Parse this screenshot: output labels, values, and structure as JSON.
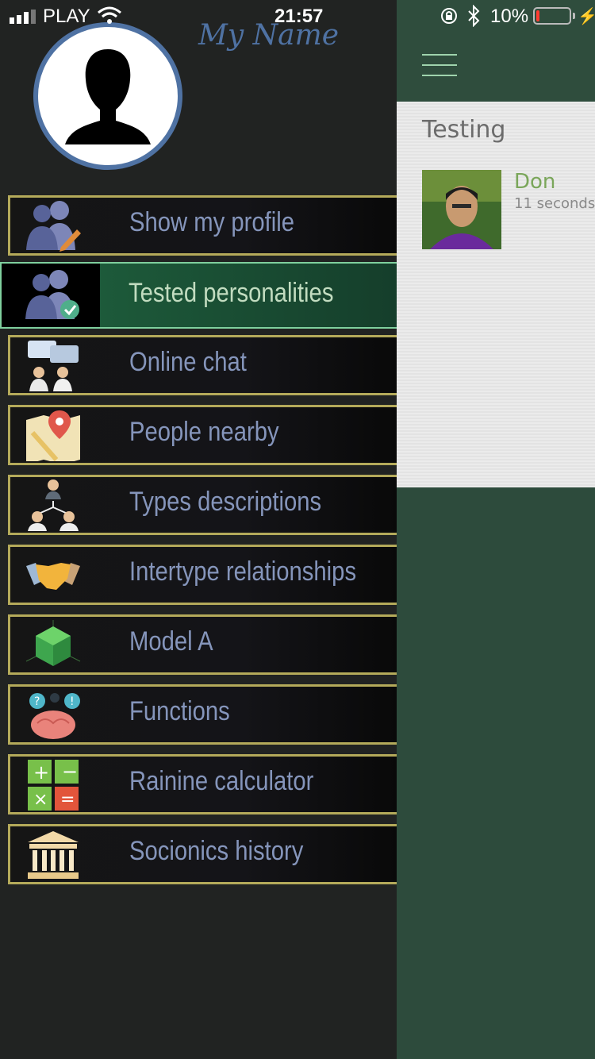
{
  "status_bar": {
    "carrier": "PLAY",
    "time": "21:57",
    "battery_percent": "10%",
    "battery_level": 0.1
  },
  "drawer": {
    "user_name": "My Name",
    "menu": [
      {
        "label": "Show my profile",
        "icon": "users-edit-icon",
        "active": false
      },
      {
        "label": "Tested personalities",
        "icon": "users-check-icon",
        "active": true
      },
      {
        "label": "Online chat",
        "icon": "chat-people-icon",
        "active": false
      },
      {
        "label": "People nearby",
        "icon": "map-pin-icon",
        "active": false
      },
      {
        "label": "Types descriptions",
        "icon": "org-chart-icon",
        "active": false
      },
      {
        "label": "Intertype relationships",
        "icon": "handshake-icon",
        "active": false
      },
      {
        "label": "Model A",
        "icon": "cube-icon",
        "active": false
      },
      {
        "label": "Functions",
        "icon": "brain-icon",
        "active": false
      },
      {
        "label": "Rainine calculator",
        "icon": "calculator-icon",
        "active": false
      },
      {
        "label": "Socionics history",
        "icon": "temple-icon",
        "active": false
      }
    ]
  },
  "content": {
    "heading": "Testing",
    "entries": [
      {
        "name": "Don",
        "time": "11 seconds"
      }
    ]
  },
  "colors": {
    "accent_blue": "#4f72a3",
    "menu_border_gold": "#b4aa5a",
    "active_green": "#1d5a3a",
    "content_green": "#2d4b3c",
    "name_green": "#7aa65a"
  }
}
